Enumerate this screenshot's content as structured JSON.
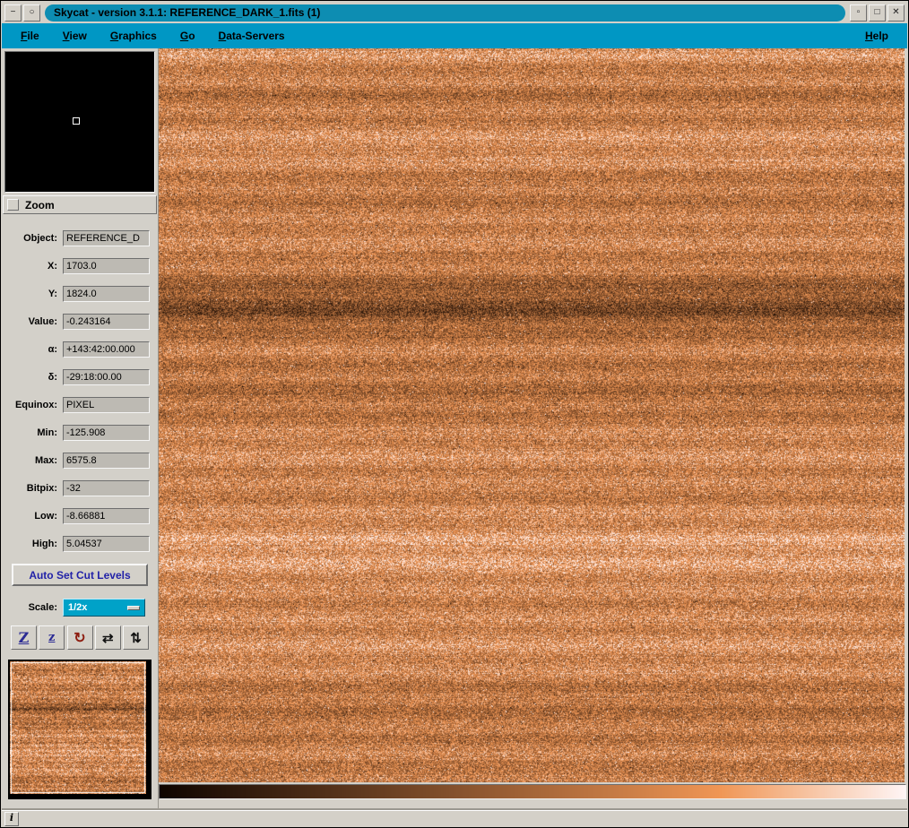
{
  "window": {
    "title": "Skycat - version 3.1.1: REFERENCE_DARK_1.fits (1)",
    "controls": {
      "menu": "−",
      "shade": "○",
      "iconify": "▫",
      "maximize": "□",
      "close": "✕"
    }
  },
  "menubar": {
    "items": [
      "File",
      "View",
      "Graphics",
      "Go",
      "Data-Servers"
    ],
    "help": "Help"
  },
  "zoom": {
    "label": "Zoom"
  },
  "info": {
    "fields": [
      {
        "label": "Object:",
        "value": "REFERENCE_D"
      },
      {
        "label": "X:",
        "value": "1703.0"
      },
      {
        "label": "Y:",
        "value": "1824.0"
      },
      {
        "label": "Value:",
        "value": "-0.243164"
      },
      {
        "label": "α:",
        "value": "+143:42:00.000"
      },
      {
        "label": "δ:",
        "value": "-29:18:00.00"
      },
      {
        "label": "Equinox:",
        "value": "PIXEL"
      },
      {
        "label": "Min:",
        "value": "-125.908"
      },
      {
        "label": "Max:",
        "value": "6575.8"
      },
      {
        "label": "Bitpix:",
        "value": "-32"
      },
      {
        "label": "Low:",
        "value": "-8.66881"
      },
      {
        "label": "High:",
        "value": "5.04537"
      }
    ],
    "auto_cut": "Auto Set Cut Levels"
  },
  "scale": {
    "label": "Scale:",
    "value": "1/2x"
  },
  "toolbar": {
    "zoom_in": "Z",
    "zoom_out": "z",
    "rotate": "↻",
    "flip_x": "⇄",
    "flip_y": "⇅"
  },
  "statusbar": {
    "info": "i"
  },
  "colors": {
    "titlebar": "#0d8db2",
    "menubar": "#0097c4",
    "panel": "#d3d0c9",
    "entry": "#bdbab3",
    "scale_dropdown": "#00a2c8",
    "button_text_blue": "#2222a8",
    "image_midtone": "#cd7d44"
  }
}
